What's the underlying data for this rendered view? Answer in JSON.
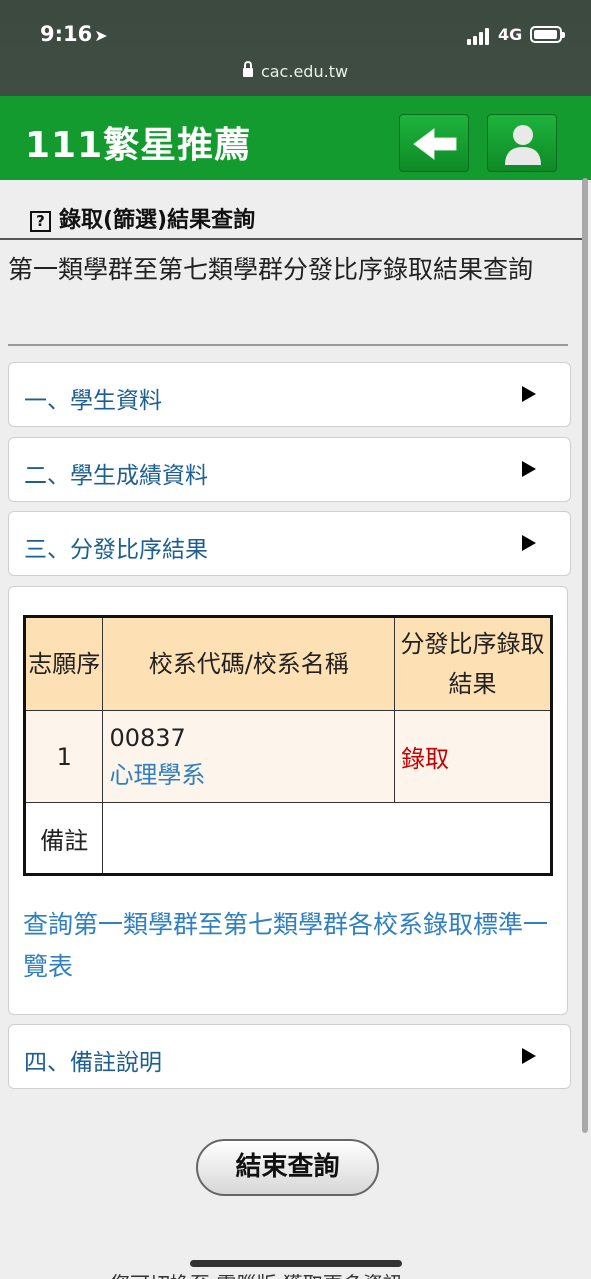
{
  "status_bar": {
    "time": "9:16",
    "network": "4G"
  },
  "browser": {
    "url": "cac.edu.tw"
  },
  "header": {
    "title": "111繁星推薦",
    "back_icon": "arrow-left-icon",
    "user_icon": "user-icon"
  },
  "section": {
    "icon_text": "?",
    "title": "錄取(篩選)結果查詢"
  },
  "page_heading": "第一類學群至第七類學群分發比序錄取結果查詢",
  "accordion": [
    {
      "label": "一、學生資料"
    },
    {
      "label": "二、學生成績資料"
    },
    {
      "label": "三、分發比序結果"
    },
    {
      "label": "四、備註說明"
    }
  ],
  "table": {
    "headers": [
      "志願序",
      "校系代碼/校系名稱",
      "分發比序錄取結果"
    ],
    "rows": [
      {
        "order": "1",
        "code": "00837",
        "dept": "心理學系",
        "result": "錄取"
      }
    ],
    "remark_label": "備註",
    "remark_value": ""
  },
  "link_text": "查詢第一類學群至第七類學群各校系錄取標準一覽表",
  "end_button": "結束查詢",
  "footer_partial": "您可切換至 電腦版 獲取更多資訊"
}
